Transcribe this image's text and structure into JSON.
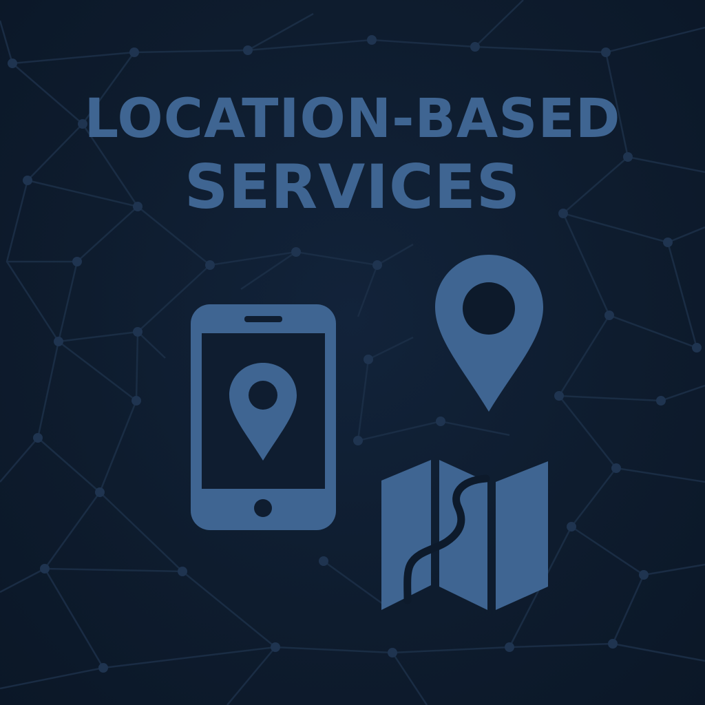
{
  "title": {
    "line1": "LOCATION-BASED",
    "line2": "SERVICES"
  },
  "icons": {
    "phone": "smartphone-with-location-pin-icon",
    "pin": "location-pin-icon",
    "map": "folded-map-icon"
  },
  "colors": {
    "background": "#0d1a2b",
    "accent": "#3f6592",
    "network_line": "#1e3149",
    "network_node": "#1f3450"
  }
}
